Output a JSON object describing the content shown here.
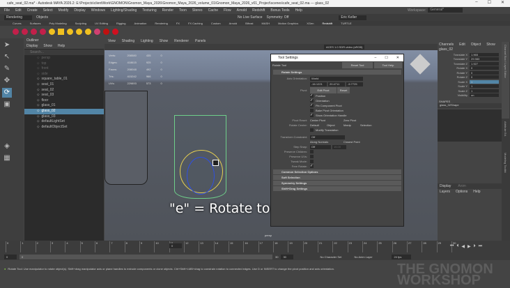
{
  "window": {
    "title": "cafe_seat_02.ma* - Autodesk MAYA 2026.2: E:\\Projects\\clientWork\\GNOMON\\Gnomon_Maya_2026\\Gnomon_Maya_2026_volume_01\\Gnomon_Maya_2026_v01_Project\\scenes\\cafe_seat_02.ma --- glass_02",
    "minimize": "–",
    "maximize": "☐",
    "close": "✕"
  },
  "menu": [
    "File",
    "Edit",
    "Create",
    "Select",
    "Modify",
    "Display",
    "Windows",
    "Lighting/Shading",
    "Texturing",
    "Render",
    "Toon",
    "Stereo",
    "Cache",
    "Flow",
    "Arnold",
    "Redshift",
    "Bonus Tools",
    "Help"
  ],
  "status": {
    "mode": "Rendering",
    "objects": "Objects",
    "live": "No Live Surface",
    "symmetry": "Symmetry: Off",
    "user": "Eric Keller",
    "workspace_label": "Workspace:",
    "workspace": "General*"
  },
  "shelf_tabs": [
    "Curves",
    "Surfaces",
    "Poly Modeling",
    "Sculpting",
    "UV Editing",
    "Rigging",
    "Animation",
    "Rendering",
    "FX",
    "FX Caching",
    "Custom",
    "Arnold",
    "Bifrost",
    "MASH",
    "Motion Graphics",
    "XGen",
    "Redshift",
    "TURTLE"
  ],
  "shelf_active": "Redshift",
  "outliner": {
    "title": "Outliner",
    "menu": [
      "Display",
      "Show",
      "Help"
    ],
    "search_placeholder": "Search...",
    "items": [
      {
        "name": "persp",
        "dim": true
      },
      {
        "name": "top",
        "dim": true
      },
      {
        "name": "front",
        "dim": true
      },
      {
        "name": "side",
        "dim": true
      },
      {
        "name": "square_table_01"
      },
      {
        "name": "seat_01"
      },
      {
        "name": "seat_02"
      },
      {
        "name": "seat_03"
      },
      {
        "name": "floor"
      },
      {
        "name": "glass_01"
      },
      {
        "name": "glass_02",
        "selected": true
      },
      {
        "name": "glass_03"
      },
      {
        "name": "defaultLightSet"
      },
      {
        "name": "defaultObjectSet"
      }
    ]
  },
  "viewport": {
    "menu": [
      "View",
      "Shading",
      "Lighting",
      "Show",
      "Renderer",
      "Panels"
    ],
    "colorspace": "ACES 1.0 SDR-video (sRGB)",
    "camera": "persp",
    "hud": [
      [
        "Verts:",
        "208580",
        "435",
        "0"
      ],
      [
        "Edges:",
        "418615",
        "925",
        "0"
      ],
      [
        "Faces:",
        "208048",
        "492",
        "0"
      ],
      [
        "Tris:",
        "415242",
        "966",
        "0"
      ],
      [
        "UVs:",
        "229893",
        "573",
        "0"
      ]
    ],
    "overlay": "\"e\" = Rotate tool"
  },
  "tool_settings": {
    "title": "Tool Settings",
    "tool": "Rotate Tool",
    "reset": "Reset Tool",
    "help": "Tool Help",
    "section": "Rotate Settings",
    "axis_label": "Axis Orientation:",
    "axis": "World",
    "xyz": [
      "-16.1221",
      "20.4711",
      "-5.7725"
    ],
    "pivot_label": "Pivot:",
    "edit_pivot": "Edit Pivot",
    "reset_pivot": "Reset",
    "checks": [
      {
        "label": "Position",
        "on": true
      },
      {
        "label": "Orientation",
        "on": true
      },
      {
        "label": "Pin Component Pivot",
        "on": true
      },
      {
        "label": "Bake Pivot Orientation",
        "on": false
      },
      {
        "label": "Show Orientation Handle",
        "on": true
      }
    ],
    "pivot_reset_label": "Pivot Reset:",
    "pivot_reset": [
      "Center Pivot",
      "Zero Pivot"
    ],
    "rotate_center_label": "Rotate Center:",
    "rotate_center": [
      "Default",
      "Object",
      "Manip",
      "Selection"
    ],
    "modify_translation": "Modify Translation",
    "constraint_label": "Transform Constraint:",
    "constraint": "Off",
    "along": [
      "Along Normals",
      "Closest Point"
    ],
    "step_label": "Step Snap:",
    "step": "Off",
    "step_val": "15.00",
    "opts": [
      {
        "label": "Preserve Children:",
        "on": false
      },
      {
        "label": "Preserve UVs:",
        "on": false
      },
      {
        "label": "Tweak Mode:",
        "on": false
      },
      {
        "label": "Free Rotate:",
        "on": true
      }
    ],
    "sections": [
      "Common Selection Options",
      "Soft Selection",
      "Symmetry Settings",
      "Shift+Drag Settings"
    ]
  },
  "channel_box": {
    "menu": [
      "Channels",
      "Edit",
      "Object",
      "Show"
    ],
    "object": "glass_02",
    "channels": [
      [
        "Translate X",
        "1.965"
      ],
      [
        "Translate Y",
        "29.983"
      ],
      [
        "Translate Z",
        "1.927"
      ],
      [
        "Rotate X",
        "0"
      ],
      [
        "Rotate Y",
        "0"
      ],
      [
        "Rotate Z",
        "0"
      ],
      [
        "Scale X",
        "1"
      ],
      [
        "Scale Y",
        "1"
      ],
      [
        "Scale Z",
        "1"
      ],
      [
        "Visibility",
        "on"
      ]
    ],
    "shapes_label": "SHAPES",
    "shape": "glass_02Shape"
  },
  "side_tabs": [
    "Channel Box / Layer Editor",
    "Attribute Ed.",
    "Modeling Toolkit"
  ],
  "layer_editor": {
    "tabs": [
      "Display",
      "Anim"
    ],
    "menu": [
      "Layers",
      "Options",
      "Help"
    ]
  },
  "timeline": {
    "ticks": [
      "0",
      "1",
      "2",
      "3",
      "4",
      "5",
      "6",
      "7",
      "8",
      "9",
      "10",
      "11",
      "12",
      "13",
      "14",
      "15",
      "16",
      "17",
      "18",
      "19",
      "20",
      "21",
      "22",
      "23",
      "24",
      "25",
      "26",
      "27",
      "28",
      "29",
      "30"
    ],
    "current": "0"
  },
  "range": {
    "start": "0",
    "inner_start": "0",
    "inner_end": "30",
    "end": "30",
    "char_set": "No Character Set",
    "anim_layer": "No Anim Layer",
    "fps": "24 fps"
  },
  "help_line": "Rotate Tool: Use manipulator to rotate object(s). Shift+drag manipulator axis or plane handles to extrude components or clone objects. Ctrl+Shift+LMB+drag to constrain rotation to connected edges. Use D or INSERT to change the pivot position and axis orientation.",
  "watermark": "THE GNOMON WORKSHOP"
}
